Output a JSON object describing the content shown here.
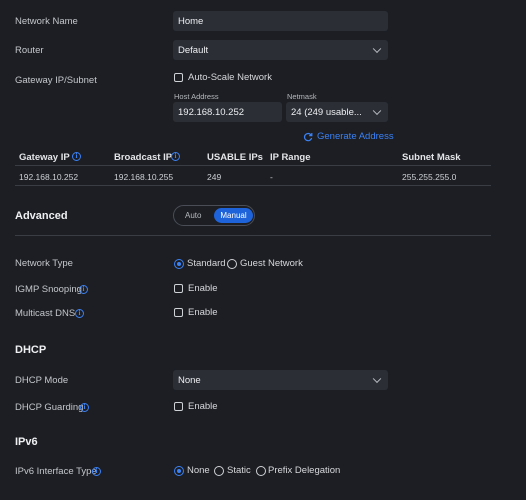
{
  "network": {
    "name_label": "Network Name",
    "name_value": "Home",
    "router_label": "Router",
    "router_value": "Default",
    "gateway_label": "Gateway IP/Subnet",
    "autoscale_label": "Auto-Scale Network",
    "host_address_label": "Host Address",
    "host_address_value": "192.168.10.252",
    "netmask_label": "Netmask",
    "netmask_value": "24 (249 usable...",
    "generate_label": "Generate Address"
  },
  "table": {
    "headers": [
      "Gateway IP",
      "Broadcast IP",
      "USABLE IPs",
      "IP Range",
      "Subnet Mask"
    ],
    "row": [
      "192.168.10.252",
      "192.168.10.255",
      "249",
      "-",
      "255.255.255.0"
    ]
  },
  "advanced": {
    "title": "Advanced",
    "toggle_auto": "Auto",
    "toggle_manual": "Manual",
    "network_type_label": "Network Type",
    "network_type_options": [
      "Standard",
      "Guest Network"
    ],
    "igmp_label": "IGMP Snooping",
    "igmp_enable": "Enable",
    "mdns_label": "Multicast DNS",
    "mdns_enable": "Enable"
  },
  "dhcp": {
    "title": "DHCP",
    "mode_label": "DHCP Mode",
    "mode_value": "None",
    "guarding_label": "DHCP Guarding",
    "guarding_enable": "Enable"
  },
  "ipv6": {
    "title": "IPv6",
    "interface_label": "IPv6 Interface Type",
    "options": [
      "None",
      "Static",
      "Prefix Delegation"
    ]
  },
  "info_glyph": "i",
  "colors": {
    "accent": "#3b82f6",
    "background": "#1c1e23",
    "field": "#2b2e35"
  }
}
